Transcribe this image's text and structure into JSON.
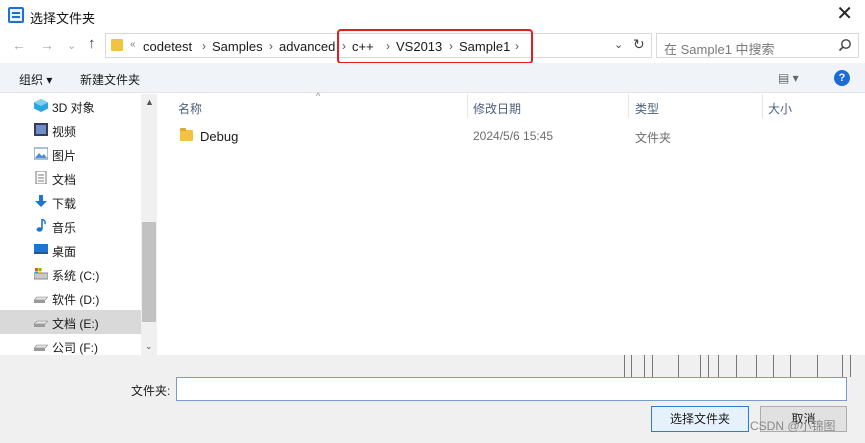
{
  "window": {
    "title": "选择文件夹",
    "close_glyph": "✕"
  },
  "nav": {
    "back_glyph": "←",
    "forward_glyph": "→",
    "dropdown_glyph": "⌄",
    "up_glyph": "↑"
  },
  "address": {
    "overflow": "«",
    "crumbs": [
      "codetest",
      "Samples",
      "advanced",
      "c++",
      "VS2013",
      "Sample1"
    ],
    "separator": "›",
    "dropdown_glyph": "⌄",
    "refresh_glyph": "↻"
  },
  "search": {
    "placeholder": "在 Sample1 中搜索"
  },
  "toolbar": {
    "organize": "组织 ▾",
    "new_folder": "新建文件夹",
    "view_glyph": "▤ ▾",
    "help": "?"
  },
  "sidebar": {
    "items": [
      {
        "label": "3D 对象",
        "icon": "3d-objects-icon"
      },
      {
        "label": "视频",
        "icon": "videos-icon"
      },
      {
        "label": "图片",
        "icon": "pictures-icon"
      },
      {
        "label": "文档",
        "icon": "documents-icon"
      },
      {
        "label": "下载",
        "icon": "downloads-icon"
      },
      {
        "label": "音乐",
        "icon": "music-icon"
      },
      {
        "label": "桌面",
        "icon": "desktop-icon"
      },
      {
        "label": "系统 (C:)",
        "icon": "drive-c-icon"
      },
      {
        "label": "软件 (D:)",
        "icon": "drive-icon"
      },
      {
        "label": "文档 (E:)",
        "icon": "drive-icon",
        "selected": true
      },
      {
        "label": "公司 (F:)",
        "icon": "drive-icon"
      }
    ],
    "scroll_up": "▲",
    "scroll_down": "⌄"
  },
  "filelist": {
    "sort_caret": "^",
    "columns": {
      "name": "名称",
      "modified": "修改日期",
      "type": "类型",
      "size": "大小"
    },
    "rows": [
      {
        "name": "Debug",
        "modified": "2024/5/6 15:45",
        "type": "文件夹",
        "size": ""
      }
    ]
  },
  "bottom": {
    "folder_label": "文件夹:",
    "folder_value": "",
    "select_button": "选择文件夹",
    "cancel_button": "取消"
  },
  "watermark": "CSDN @小锦图",
  "colors": {
    "highlight": "#e02020",
    "accent": "#1c6cd5",
    "folder": "#f4c242"
  }
}
